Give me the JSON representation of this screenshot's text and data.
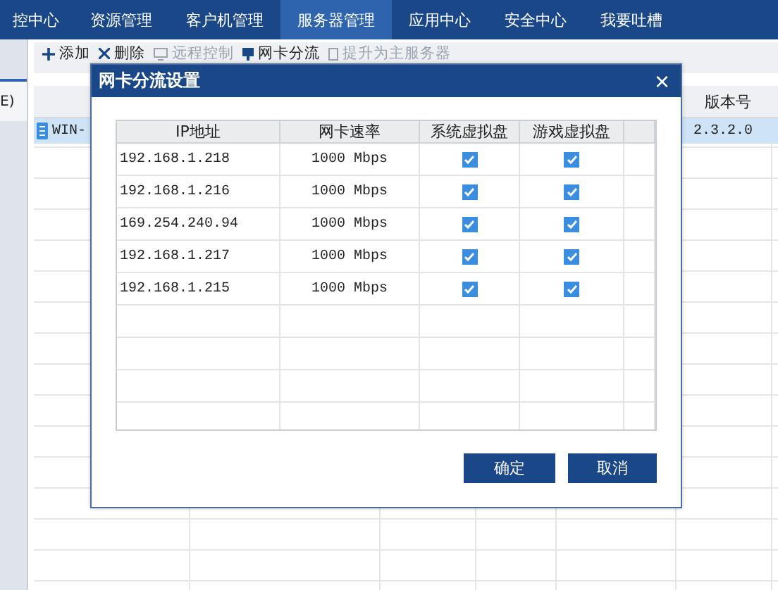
{
  "nav": [
    {
      "label": "控中心",
      "selected": false
    },
    {
      "label": "资源管理",
      "selected": false
    },
    {
      "label": "客户机管理",
      "selected": false
    },
    {
      "label": "服务器管理",
      "selected": true
    },
    {
      "label": "应用中心",
      "selected": false
    },
    {
      "label": "安全中心",
      "selected": false
    },
    {
      "label": "我要吐槽",
      "selected": false
    }
  ],
  "sidebar": {
    "items": [
      {
        "label": "E)",
        "selected": true
      }
    ]
  },
  "toolbar": [
    {
      "kind": "add",
      "label": "添加",
      "disabled": false
    },
    {
      "kind": "delete",
      "label": "删除",
      "disabled": false
    },
    {
      "kind": "remote",
      "label": "远程控制",
      "disabled": true
    },
    {
      "kind": "nic",
      "label": "网卡分流",
      "disabled": false
    },
    {
      "kind": "promote",
      "label": "提升为主服务器",
      "disabled": true
    }
  ],
  "table": {
    "column_6": "版本号",
    "rows": [
      {
        "name": "WIN-",
        "version": "2.3.2.0",
        "selected": true
      }
    ]
  },
  "dialog": {
    "title": "网卡分流设置",
    "close": "×",
    "columns": [
      "IP地址",
      "网卡速率",
      "系统虚拟盘",
      "游戏虚拟盘"
    ],
    "rows": [
      {
        "ip": "192.168.1.218",
        "speed": "1000 Mbps",
        "system_disk": true,
        "game_disk": true
      },
      {
        "ip": "192.168.1.216",
        "speed": "1000 Mbps",
        "system_disk": true,
        "game_disk": true
      },
      {
        "ip": "169.254.240.94",
        "speed": "1000 Mbps",
        "system_disk": true,
        "game_disk": true
      },
      {
        "ip": "192.168.1.217",
        "speed": "1000 Mbps",
        "system_disk": true,
        "game_disk": true
      },
      {
        "ip": "192.168.1.215",
        "speed": "1000 Mbps",
        "system_disk": true,
        "game_disk": true
      }
    ],
    "buttons": [
      "确定",
      "取消"
    ]
  }
}
